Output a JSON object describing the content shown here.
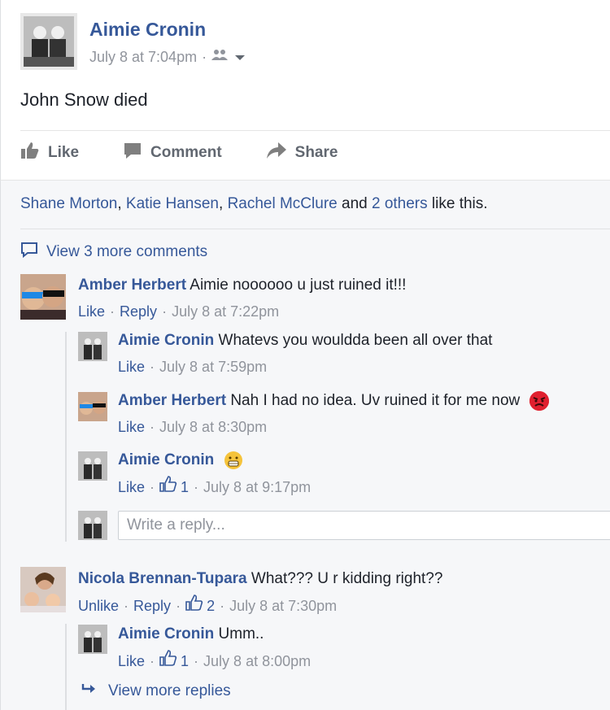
{
  "post": {
    "author": "Aimie Cronin",
    "timestamp": "July 8 at 7:04pm",
    "separator": "·",
    "audience_icon": "friends-icon",
    "text": "John Snow died",
    "actions": {
      "like": "Like",
      "comment": "Comment",
      "share": "Share"
    }
  },
  "reactions": {
    "names": [
      "Shane Morton",
      "Katie Hansen",
      "Rachel McClure"
    ],
    "comma": ",",
    "and_text": "and",
    "others": "2 others",
    "suffix": "like this."
  },
  "view_more_comments": "View 3 more comments",
  "comments": [
    {
      "author": "Amber Herbert",
      "text": "Aimie noooooo u just ruined it!!!",
      "actions": [
        "Like",
        "Reply"
      ],
      "time": "July 8 at 7:22pm",
      "replies": [
        {
          "author": "Aimie Cronin",
          "text": "Whatevs you wouldda been all over that",
          "like": "Like",
          "time": "July 8 at 7:59pm"
        },
        {
          "author": "Amber Herbert",
          "text": "Nah I had no idea. Uv ruined it for me now",
          "emoji": "angry-face",
          "like": "Like",
          "time": "July 8 at 8:30pm"
        },
        {
          "author": "Aimie Cronin",
          "text": "",
          "emoji": "grimacing-face",
          "like": "Like",
          "like_count": "1",
          "time": "July 8 at 9:17pm"
        }
      ],
      "reply_placeholder": "Write a reply..."
    },
    {
      "author": "Nicola Brennan-Tupara",
      "text": "What??? U r kidding right??",
      "actions": [
        "Unlike",
        "Reply"
      ],
      "like_count": "2",
      "time": "July 8 at 7:30pm",
      "replies": [
        {
          "author": "Aimie Cronin",
          "text": "Umm..",
          "like": "Like",
          "like_count": "1",
          "time": "July 8 at 8:00pm"
        }
      ],
      "view_more_replies": "View more replies"
    }
  ],
  "colors": {
    "link": "#365899",
    "meta": "#90949c",
    "background": "#f6f7f9",
    "angry": "#e0202f",
    "grimace": "#f5c33b"
  }
}
